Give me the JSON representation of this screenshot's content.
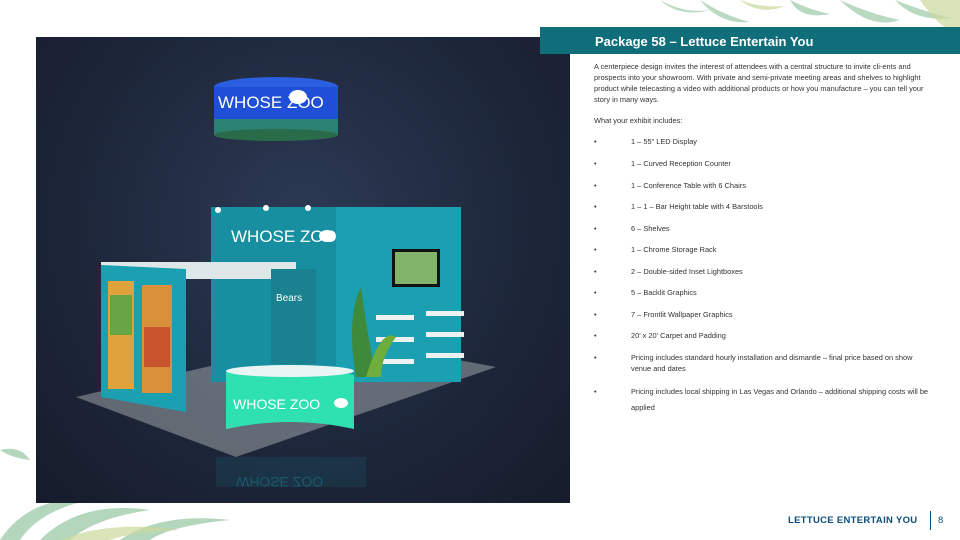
{
  "slide": {
    "title": "Package 58 – Lettuce Entertain You",
    "intro": "A centerpiece design invites the interest of attendees with a central structure to invite cli-ents and prospects into your showroom.  With private and semi-private meeting areas and shelves to highlight product while telecasting a video with additional products or how you manufacture – you can tell your story in many ways.",
    "includes_label": "What your exhibit includes:",
    "bullet_symbol": "•",
    "items": [
      "1 – 55\" LED Display",
      "1 – Curved Reception Counter",
      "1 – Conference Table with 6 Chairs",
      "1 – 1 – Bar Height table with 4 Barstools",
      "6 – Shelves",
      "1 – Chrome Storage Rack",
      "2 – Double-sided Inset Lightboxes",
      "5 – Backlit Graphics",
      "7 – Frontlit Wallpaper Graphics",
      "20' x 20' Carpet and Padding",
      "Pricing includes standard hourly installation and dismantle – final price based on show venue and dates",
      "Pricing includes local shipping in Las Vegas and Orlando – additional shipping costs will be applied"
    ]
  },
  "booth": {
    "hanging_sign": "WHOSE ZOO",
    "tower_sign": "WHOSE ZOO",
    "counter_sign": "WHOSE ZOO",
    "reflection_sign": "WHOSE ZOO",
    "wall_sign": "Bears"
  },
  "footer": {
    "brand": "LETTUCE ENTERTAIN YOU",
    "page_number": "8"
  },
  "colors": {
    "accent": "#0f6e7a",
    "footer_text": "#0f4d7a",
    "booth_teal": "#1aa0b0",
    "counter_green": "#2fe0b0",
    "sign_blue": "#1e4fd6"
  },
  "icons": [
    "elephant-icon",
    "palm-leaf-decoration"
  ]
}
